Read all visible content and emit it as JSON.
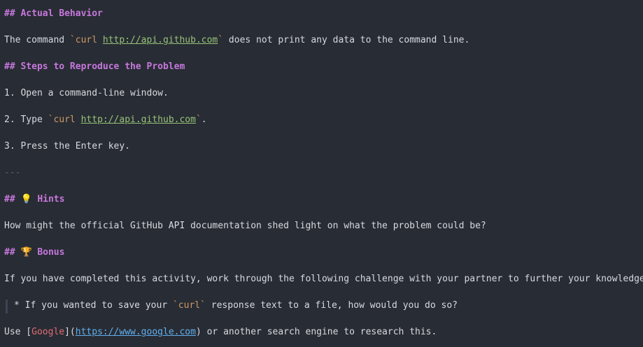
{
  "doc": {
    "actual_heading": "Actual Behavior",
    "actual_pre": "The command ",
    "actual_code_start": "`curl ",
    "actual_url": "http://api.github.com",
    "actual_code_end": "`",
    "actual_post": " does not print any data to the command line.",
    "steps_heading": "Steps to Reproduce the Problem",
    "step1": "1. Open a command-line window.",
    "step2_pre": "2. Type ",
    "step2_code_start": "`curl ",
    "step2_url": "http://api.github.com",
    "step2_code_end": "`",
    "step2_post": ".",
    "step3": "3. Press the Enter key.",
    "hr": "---",
    "hints_heading": "Hints",
    "hints_text": "How might the official GitHub API documentation shed light on what the problem could be?",
    "bonus_heading": "Bonus",
    "bonus_text": "If you have completed this activity, work through the following challenge with your partner to further your knowledge:",
    "bullet_pre": "* If you wanted to save your ",
    "bullet_code": "`curl`",
    "bullet_post": " response text to a file, how would you do so?",
    "use_pre": "Use [",
    "use_link_text": "Google",
    "use_mid": "](",
    "use_link_url": "https://www.google.com",
    "use_post": ") or another search engine to research this.",
    "hashes": "## ",
    "bulb_icon": "💡",
    "trophy_icon": "🏆"
  }
}
